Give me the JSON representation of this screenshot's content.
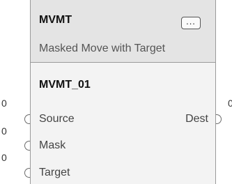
{
  "block": {
    "name": "MVMT",
    "description": "Masked Move with Target",
    "instance": "MVMT_01",
    "properties_button": "..."
  },
  "pins": {
    "inputs": [
      {
        "label": "Source",
        "value": "0"
      },
      {
        "label": "Mask",
        "value": "0"
      },
      {
        "label": "Target",
        "value": "0"
      }
    ],
    "outputs": [
      {
        "label": "Dest",
        "value": "0"
      }
    ]
  }
}
